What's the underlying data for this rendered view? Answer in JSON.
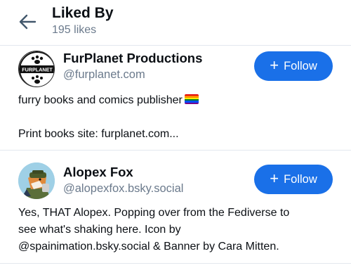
{
  "header": {
    "title": "Liked By",
    "subtitle": "195 likes"
  },
  "users": [
    {
      "name": "FurPlanet Productions",
      "handle": "@furplanet.com",
      "follow_label": "Follow",
      "bio_line1": "furry books and comics publisher",
      "bio_line3": "Print books site: furplanet.com...",
      "avatar_text": "FURPLANET",
      "bio_emoji": "rainbow-flag"
    },
    {
      "name": "Alopex Fox",
      "handle": "@alopexfox.bsky.social",
      "follow_label": "Follow",
      "bio_line1": "Yes, THAT Alopex. Popping over from the Fediverse to",
      "bio_line2": "see what's shaking here. Icon by",
      "bio_line3": "@spainimation.bsky.social & Banner by Cara Mitten."
    }
  ],
  "icons": {
    "back": "arrow-left-icon",
    "plus": "plus-icon"
  },
  "colors": {
    "accent": "#1a70e8",
    "muted": "#6b7a8c",
    "divider": "#e3e8ee"
  }
}
